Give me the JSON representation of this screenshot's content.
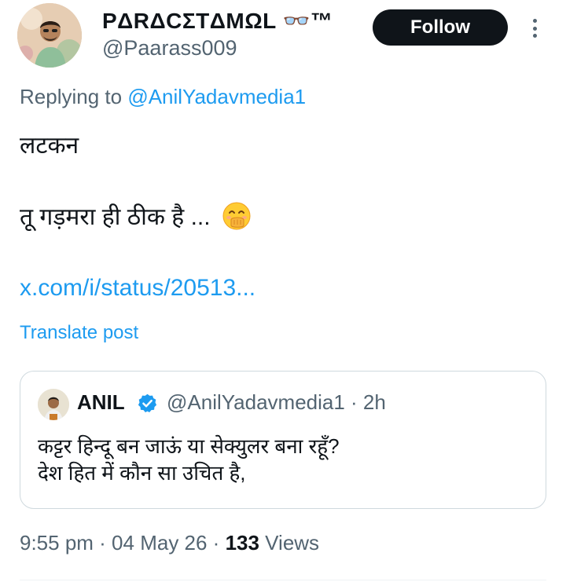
{
  "post": {
    "author": {
      "display_name": "PΔRΔCΣTΔMΩL 👓™",
      "handle": "@Paarass009"
    },
    "follow_label": "Follow",
    "replying_prefix": "Replying to ",
    "replying_to": "@AnilYadavmedia1",
    "text_line1": "लटकन",
    "text_line2": "तू गड़मरा ही ठीक है ...",
    "link": "x.com/i/status/20513...",
    "translate_label": "Translate post",
    "timestamp": "9:55 pm · 04 May 26 · ",
    "views_count": "133",
    "views_label": " Views"
  },
  "quoted_post": {
    "name": "ANIL",
    "handle_time": "@AnilYadavmedia1 · 2h",
    "text_line1": "कट्टर हिन्दू बन जाऊं या सेक्युलर बना रहूँ?",
    "text_line2": "देश हित में कौन सा उचित है,"
  },
  "icons": {
    "more": "more-vertical-icon",
    "verified": "verified-badge-icon",
    "emoji": "face-with-hand-over-mouth-emoji"
  },
  "colors": {
    "link_blue": "#1d9bf0",
    "text_primary": "#0f1419",
    "text_secondary": "#536471",
    "follow_bg": "#0f1419",
    "border": "#cfd9de"
  }
}
